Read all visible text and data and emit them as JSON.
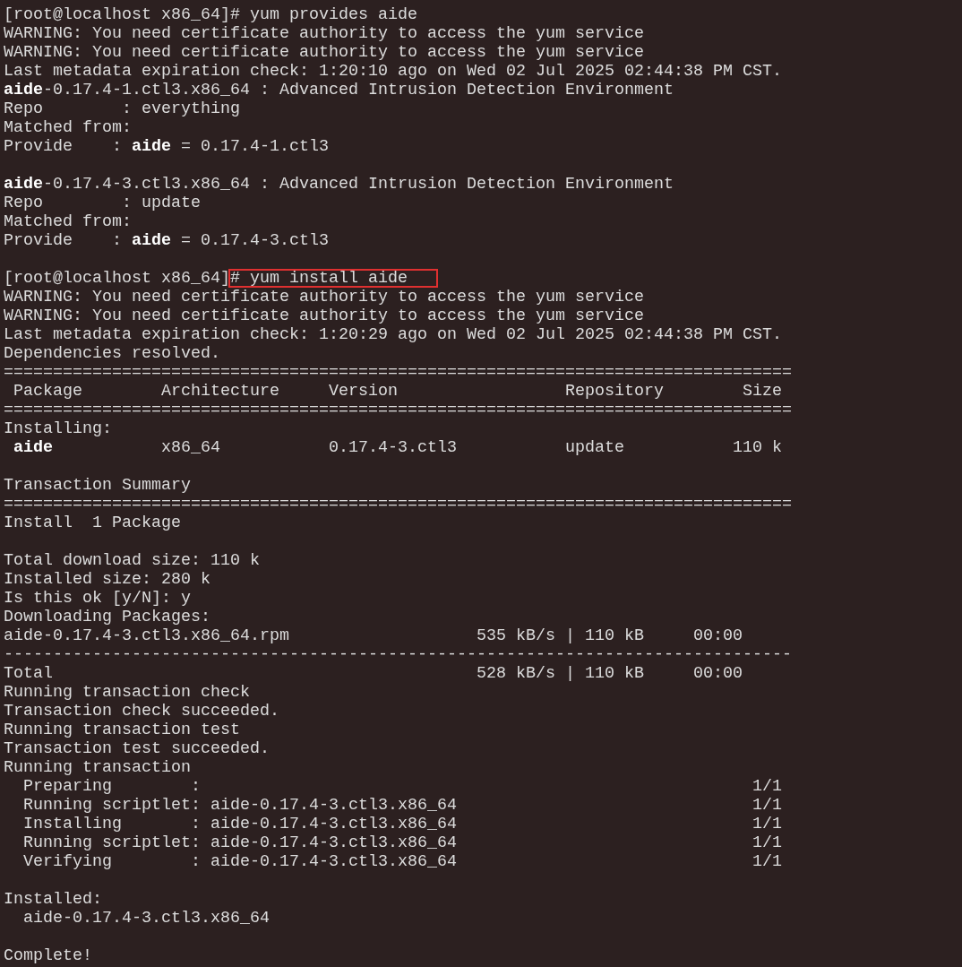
{
  "terminal": {
    "blocks": [
      [
        "[root@localhost x86_64]# yum provides aide",
        "WARNING: You need certificate authority to access the yum service",
        "WARNING: You need certificate authority to access the yum service",
        "Last metadata expiration check: 1:20:10 ago on Wed 02 Jul 2025 02:44:38 PM CST.",
        "**aide**-0.17.4-1.ctl3.x86_64 : Advanced Intrusion Detection Environment",
        "Repo        : everything",
        "Matched from:",
        "Provide    : **aide** = 0.17.4-1.ctl3"
      ],
      [
        "**aide**-0.17.4-3.ctl3.x86_64 : Advanced Intrusion Detection Environment",
        "Repo        : update",
        "Matched from:",
        "Provide    : **aide** = 0.17.4-3.ctl3"
      ],
      [
        {
          "prompt": "[root@localhost x86_64]",
          "command": "# yum install aide",
          "highlighted": true
        },
        "WARNING: You need certificate authority to access the yum service",
        "WARNING: You need certificate authority to access the yum service",
        "Last metadata expiration check: 1:20:29 ago on Wed 02 Jul 2025 02:44:38 PM CST.",
        "Dependencies resolved.",
        "================================================================================",
        " Package        Architecture     Version                 Repository        Size",
        "================================================================================",
        "Installing:",
        " **aide**           x86_64           0.17.4-3.ctl3           update           110 k"
      ],
      [
        "Transaction Summary",
        "================================================================================",
        "Install  1 Package"
      ],
      [
        "Total download size: 110 k",
        "Installed size: 280 k",
        "Is this ok [y/N]: y",
        "Downloading Packages:",
        "aide-0.17.4-3.ctl3.x86_64.rpm                   535 kB/s | 110 kB     00:00",
        "--------------------------------------------------------------------------------",
        "Total                                           528 kB/s | 110 kB     00:00",
        "Running transaction check",
        "Transaction check succeeded.",
        "Running transaction test",
        "Transaction test succeeded.",
        "Running transaction",
        "  Preparing        :                                                        1/1",
        "  Running scriptlet: aide-0.17.4-3.ctl3.x86_64                              1/1",
        "  Installing       : aide-0.17.4-3.ctl3.x86_64                              1/1",
        "  Running scriptlet: aide-0.17.4-3.ctl3.x86_64                              1/1",
        "  Verifying        : aide-0.17.4-3.ctl3.x86_64                              1/1"
      ],
      [
        "Installed:",
        "  aide-0.17.4-3.ctl3.x86_64"
      ],
      [
        "Complete!"
      ]
    ]
  }
}
